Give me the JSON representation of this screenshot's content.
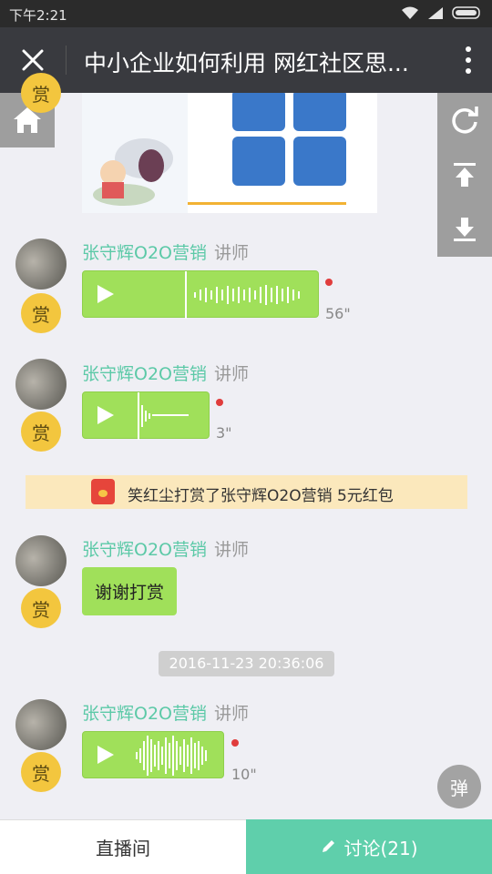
{
  "statusbar": {
    "time": "下午2:21"
  },
  "navbar": {
    "title": "中小企业如何利用 网红社区思..."
  },
  "messages": [
    {
      "name": "张守辉O2O营销",
      "role": "讲师",
      "reward": "赏",
      "duration": "56\""
    },
    {
      "name": "张守辉O2O营销",
      "role": "讲师",
      "reward": "赏",
      "duration": "3\""
    },
    {
      "name": "张守辉O2O营销",
      "role": "讲师",
      "reward": "赏",
      "text": "谢谢打赏"
    },
    {
      "name": "张守辉O2O营销",
      "role": "讲师",
      "reward": "赏",
      "duration": "10\""
    }
  ],
  "notice": {
    "text": "笑红尘打赏了张守辉O2O营销 5元红包"
  },
  "timestamp": "2016-11-23 20:36:06",
  "danmu_label": "弹",
  "tabs": {
    "live": "直播间",
    "discuss": "讨论(21)"
  },
  "colors": {
    "accent": "#5fcfab",
    "voice_bubble": "#a0e05a",
    "reward": "#f3c63e"
  }
}
